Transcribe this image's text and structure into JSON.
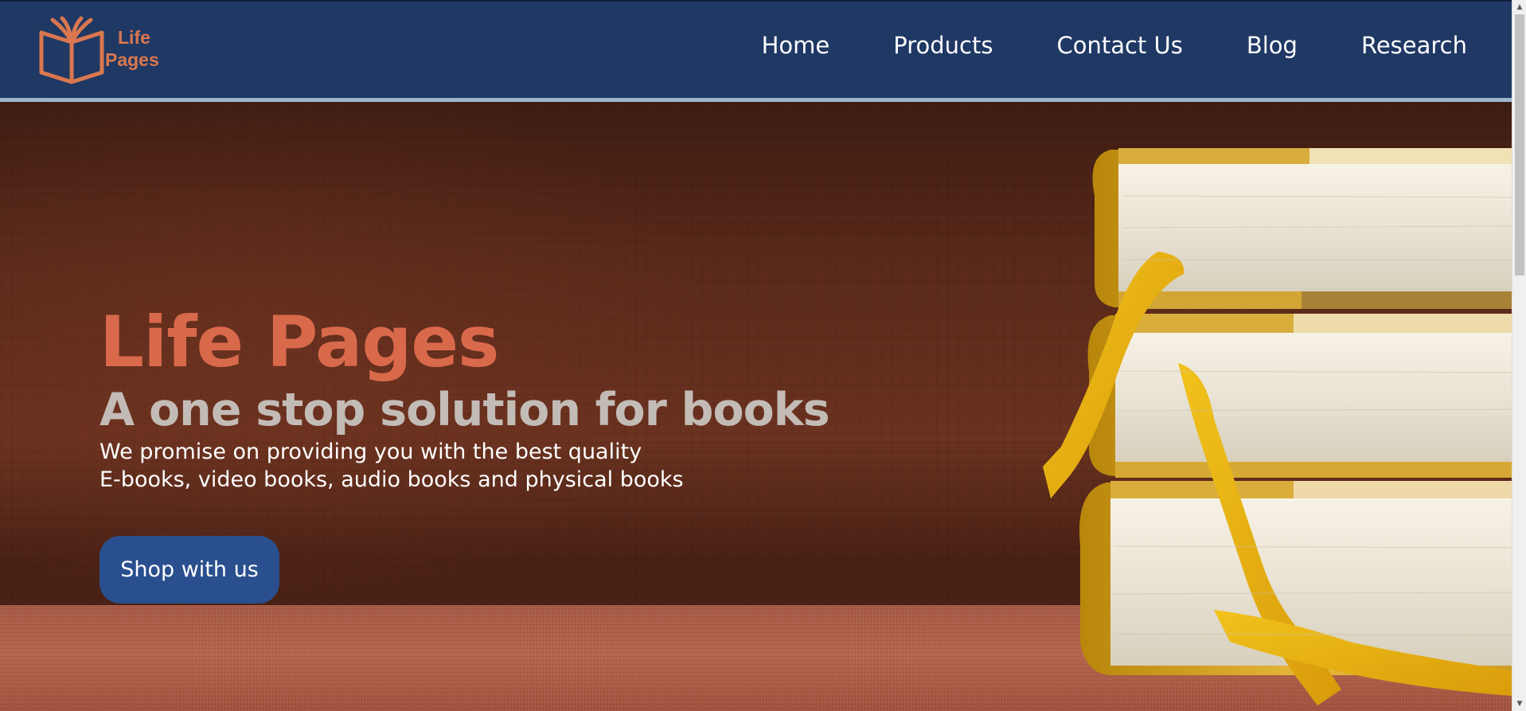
{
  "header": {
    "logo": {
      "line1": "Life",
      "line2": "Pages",
      "icon": "open-book-icon"
    },
    "nav": [
      {
        "label": "Home"
      },
      {
        "label": "Products"
      },
      {
        "label": "Contact Us"
      },
      {
        "label": "Blog"
      },
      {
        "label": "Research"
      }
    ]
  },
  "hero": {
    "title": "Life Pages",
    "subtitle": "A one stop solution for books",
    "description_line1": "We promise on providing you with the best quality",
    "description_line2": "E-books, video books, audio books and physical books",
    "cta_label": "Shop with us"
  },
  "colors": {
    "header_bg": "#1f3864",
    "accent": "#d9694b",
    "cta_bg": "#2a4f8f"
  }
}
